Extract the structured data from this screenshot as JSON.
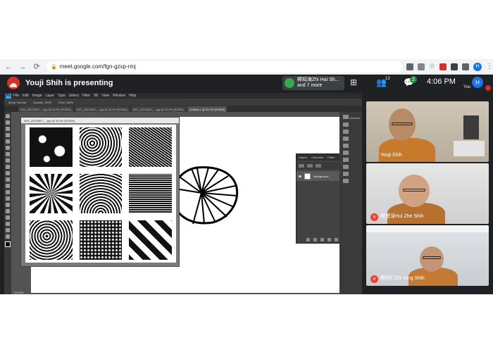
{
  "browser": {
    "url": "meet.google.com/fgn-gzxp-rmj",
    "profile_initial": "H",
    "colors": {
      "profile": "#1a73e8"
    }
  },
  "meet": {
    "presenting_label": "Youji Shih is presenting",
    "participants_chip_line1": "釋知海Zhi Hai Sh...",
    "participants_chip_line2": "and 7 more",
    "people_count": "13",
    "chat_count": "2",
    "time": "4:06 PM",
    "self_initial": "H",
    "self_label": "You"
  },
  "photoshop": {
    "logo": "Ps",
    "menus": [
      "File",
      "Edit",
      "Image",
      "Layer",
      "Type",
      "Select",
      "Filter",
      "3D",
      "View",
      "Window",
      "Help"
    ],
    "tabs": [
      "IMG_20200827_...jpg @ 33.3% (RGB/8)",
      "IMG_20200827_...jpg @ 33.3% (RGB/8)",
      "IMG_20200827_...jpg @ 33.3% (RGB/8)",
      "Untitled-1 @ 33.3% (RGB/8)"
    ],
    "options": [
      "Mode: Normal",
      "Opacity: 100%",
      "Flow: 100%"
    ],
    "ref_title": "IMG_20200827_...jpg @ 33.3% (RGB/8)",
    "layers_tabs": [
      "Layers",
      "Channels",
      "Paths"
    ],
    "layer_name": "Background",
    "right_panel_label": "Libraries",
    "status": "33.33%"
  },
  "participants": [
    {
      "name": "Youji Shih",
      "muted": false
    },
    {
      "name": "釋慧深Hui Zhe Shih",
      "muted": true
    },
    {
      "name": "釋知行Zhi Xing Shih",
      "muted": true
    }
  ]
}
